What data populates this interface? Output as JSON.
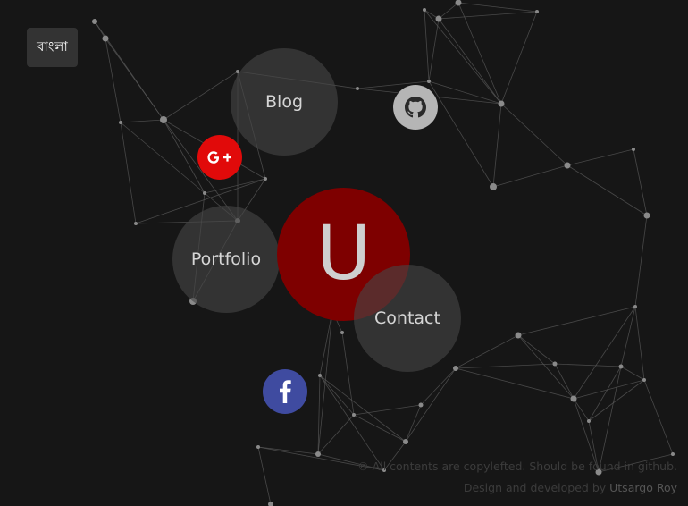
{
  "language_button": {
    "label": "বাংলা"
  },
  "center_logo": {
    "letter": "U",
    "color": "#7e0000"
  },
  "nav": {
    "blog": "Blog",
    "portfolio": "Portfolio",
    "contact": "Contact"
  },
  "social": {
    "google_plus": {
      "icon": "google-plus-icon",
      "color": "#e10a0a"
    },
    "github": {
      "icon": "github-icon",
      "color": "#b5b5b5"
    },
    "facebook": {
      "icon": "facebook-icon",
      "color": "#3f4ba0"
    }
  },
  "footer": {
    "copyright": "© All contents are copylefted. Should be found in github.",
    "credit_prefix": "Design and developed by ",
    "author": "Utsargo Roy"
  },
  "colors": {
    "background": "#161616",
    "network_line": "#5a5a5a",
    "network_node": "#8a8a8a"
  }
}
